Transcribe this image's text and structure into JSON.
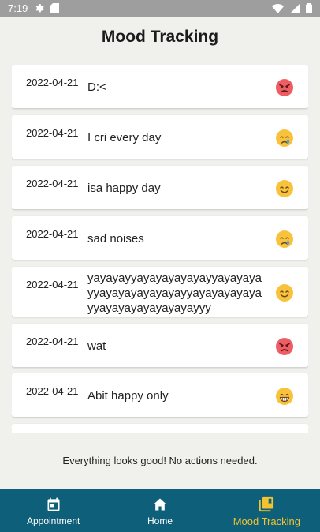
{
  "status_bar": {
    "time": "7:19"
  },
  "title": "Mood Tracking",
  "entries": [
    {
      "date": "2022-04-21",
      "text": "D:<",
      "emoji": "angry-face-icon"
    },
    {
      "date": "2022-04-21",
      "text": "I cri every day",
      "emoji": "crying-face-icon"
    },
    {
      "date": "2022-04-21",
      "text": "isa happy day",
      "emoji": "smiling-face-icon"
    },
    {
      "date": "2022-04-21",
      "text": "sad noises",
      "emoji": "crying-face-icon"
    },
    {
      "date": "2022-04-21",
      "text": "yayayayyayayayayayayyayayaya yyayayayayayayayyayayayayaya yyayayayayayayayayyy",
      "emoji": "smiling-face-icon"
    },
    {
      "date": "2022-04-21",
      "text": "wat",
      "emoji": "angry-face-icon"
    },
    {
      "date": "2022-04-21",
      "text": "Abit happy only",
      "emoji": "grinning-face-icon"
    }
  ],
  "footer_message": "Everything looks good! No actions needed.",
  "nav": [
    {
      "label": "Appointment",
      "icon": "calendar-icon"
    },
    {
      "label": "Home",
      "icon": "home-icon"
    },
    {
      "label": "Mood Tracking",
      "icon": "journal-icon"
    }
  ],
  "colors": {
    "nav_background": "#0e5f7a",
    "nav_active": "#f2c231",
    "status_bar": "#9e9e9e",
    "page_background": "#f0f0ec"
  }
}
